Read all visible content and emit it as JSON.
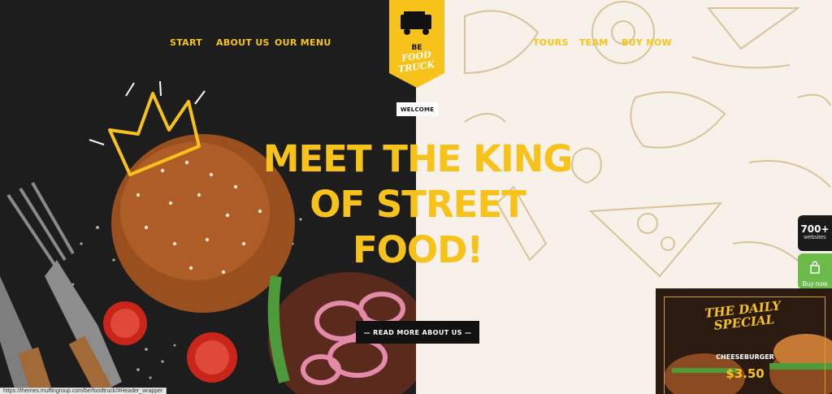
{
  "nav": {
    "left": [
      "START",
      "ABOUT US",
      "OUR MENU"
    ],
    "right": [
      "TOURS",
      "TEAM",
      "BUY NOW"
    ]
  },
  "logo": {
    "line1": "BE",
    "line2": "FOOD",
    "line3": "TRUCK"
  },
  "hero": {
    "welcome": "WELCOME",
    "title_lines": [
      "MEET THE KING",
      "OF STREET",
      "FOOD!"
    ],
    "button": "— READ MORE ABOUT US —"
  },
  "widgets": {
    "websites_count": "700+",
    "websites_label": "websites",
    "buy_now_label": "Buy now"
  },
  "special": {
    "title_line1": "THE DAILY",
    "title_line2": "SPECIAL",
    "item": "CHEESEBURGER",
    "price": "$3.50"
  },
  "status_url": "https://themes.muffingroup.com/be/foodtruck/#Header_wrapper",
  "colors": {
    "accent_yellow": "#f7c31b",
    "dark": "#1d1d1d",
    "cream": "#f7f1ea",
    "green": "#6cba4a"
  }
}
